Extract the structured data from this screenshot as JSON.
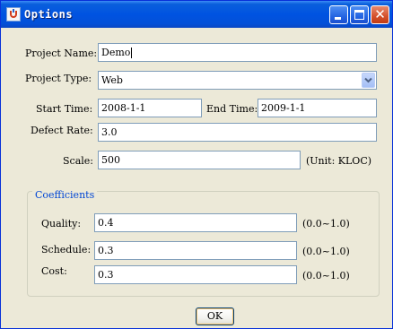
{
  "window": {
    "title": "Options"
  },
  "form": {
    "project_name": {
      "label": "Project Name:",
      "value": "Demo"
    },
    "project_type": {
      "label": "Project Type:",
      "value": "Web"
    },
    "start_time": {
      "label": "Start Time:",
      "value": "2008-1-1"
    },
    "end_time": {
      "label": "End Time:",
      "value": "2009-1-1"
    },
    "defect_rate": {
      "label": "Defect Rate:",
      "value": "3.0"
    },
    "scale": {
      "label": "Scale:",
      "value": "500",
      "unit": "(Unit: KLOC)"
    }
  },
  "coefficients": {
    "title": "Coefficients",
    "quality": {
      "label": "Quality:",
      "value": "0.4",
      "range": "(0.0~1.0)"
    },
    "schedule": {
      "label": "Schedule:",
      "value": "0.3",
      "range": "(0.0~1.0)"
    },
    "cost": {
      "label": "Cost:",
      "value": "0.3",
      "range": "(0.0~1.0)"
    }
  },
  "buttons": {
    "ok": "OK"
  },
  "colors": {
    "titlebar": "#0053e1",
    "window_bg": "#ece9d8",
    "group_title": "#0046d5",
    "close_button": "#d4502b"
  }
}
